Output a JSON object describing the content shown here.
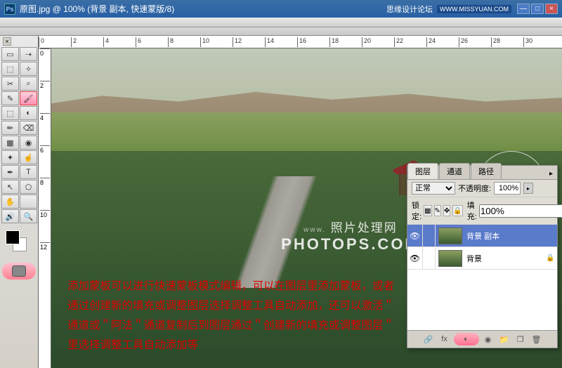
{
  "titlebar": {
    "ps": "Ps",
    "title": "原图.jpg @ 100% (背景 副本, 快速蒙版/8)",
    "brand": "思缘设计论坛",
    "url": "WWW.MISSYUAN.COM",
    "min": "—",
    "max": "□",
    "close": "×"
  },
  "ruler_h": [
    "0",
    "2",
    "4",
    "6",
    "8",
    "10",
    "12",
    "14",
    "16",
    "18",
    "20",
    "22",
    "24",
    "26",
    "28",
    "30"
  ],
  "ruler_v": [
    "0",
    "2",
    "4",
    "6",
    "8",
    "10",
    "12"
  ],
  "tools": {
    "r1c1": "▭",
    "r1c2": "⇢",
    "r2c1": "⬚",
    "r2c2": "✧",
    "r3c1": "✂",
    "r3c2": "⌕",
    "r4c1": "✎",
    "r4c2": "🖌",
    "r5c1": "⬚",
    "r5c2": "◐",
    "r6c1": "✏",
    "r6c2": "⌫",
    "r7c1": "▦",
    "r7c2": "◉",
    "r8c1": "✦",
    "r8c2": "☝",
    "r9c1": "✒",
    "r9c2": "T",
    "r10c1": "↖",
    "r10c2": "⬠",
    "r11c1": "✋",
    "r11c2": "",
    "r12c1": "🔊",
    "r12c2": "🔍"
  },
  "watermark": {
    "www": "www.",
    "cn": "照片处理网",
    "en": "PHOTOPS.COM"
  },
  "redtext": "添加蒙板可以进行快速蒙板模式编辑，可以在图层里添加蒙板，或者通过创建新的填充或调整图层选择调整工具自动添加，还可以激活＂通道或＂阿法＂通道复制后到图层通过＂创建新的填充或调整图层＂里选择调整工具自动添加等",
  "layers": {
    "tabs": {
      "t1": "图层",
      "t2": "通道",
      "t3": "路径",
      "menu": "▸"
    },
    "blend_label": "正常",
    "opacity_label": "不透明度:",
    "opacity_val": "100%",
    "lock_label": "锁定:",
    "fill_label": "填充:",
    "fill_val": "100%",
    "items": [
      {
        "name": "背景 副本",
        "sel": true,
        "lock": ""
      },
      {
        "name": "背景",
        "sel": false,
        "lock": "🔒"
      }
    ],
    "bottom": {
      "b1": "🔗",
      "b2": "fx",
      "b3": "◐",
      "b4": "◉",
      "b5": "📁",
      "b6": "❐",
      "b7": "🗑"
    }
  }
}
